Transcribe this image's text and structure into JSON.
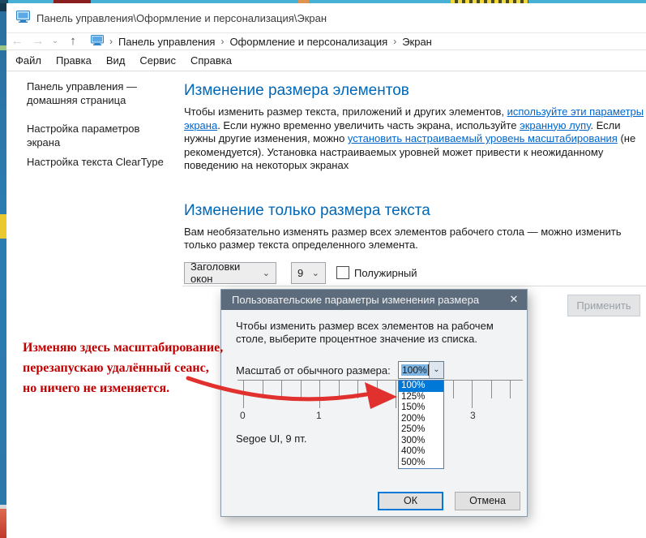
{
  "window": {
    "title": "Панель управления\\Оформление и персонализация\\Экран"
  },
  "icons": {
    "back": "←",
    "forward": "→",
    "dropdown_small": "⌄",
    "up": "↑",
    "breadcrumb_sep": "›",
    "combo_chevron": "⌄",
    "close": "✕"
  },
  "nav": {
    "breadcrumb": [
      "Панель управления",
      "Оформление и персонализация",
      "Экран"
    ]
  },
  "menu": {
    "items": [
      "Файл",
      "Правка",
      "Вид",
      "Сервис",
      "Справка"
    ]
  },
  "sidebar": {
    "items": [
      "Панель управления — домашняя страница",
      "Настройка параметров экрана",
      "Настройка текста ClearType"
    ]
  },
  "main": {
    "section1": {
      "title": "Изменение размера элементов",
      "t1": "Чтобы изменить размер текста, приложений и других элементов, ",
      "link1": "используйте эти параметры экрана",
      "t2": ". Если нужно временно увеличить часть экрана, используйте ",
      "link2": "экранную лупу",
      "t3": ". Если нужны другие изменения, можно ",
      "link3": "установить настраиваемый уровень масштабирования",
      "t4": " (не рекомендуется). Установка настраиваемых уровней может привести к неожиданному поведению на некоторых экранах"
    },
    "section2": {
      "title": "Изменение только размера текста",
      "body": "Вам необязательно изменять размер всех элементов рабочего стола — можно изменить только размер текста определенного элемента.",
      "element_combo_value": "Заголовки окон",
      "size_combo_value": "9",
      "bold_checkbox_label": "Полужирный"
    },
    "apply_button": "Применить"
  },
  "dialog": {
    "title": "Пользовательские параметры изменения размера",
    "body": "Чтобы изменить размер всех элементов на рабочем столе, выберите процентное значение из списка.",
    "scale_label": "Масштаб от обычного размера:",
    "combo_value": "100%",
    "ruler_labels": [
      "0",
      "1",
      "3"
    ],
    "font_note": "Segoe UI, 9 пт.",
    "options": [
      "100%",
      "125%",
      "150%",
      "200%",
      "250%",
      "300%",
      "400%",
      "500%"
    ],
    "selected_option": "100%",
    "ok_button": "ОК",
    "cancel_button": "Отмена"
  },
  "annotation": {
    "line1": "Изменяю здесь масштабирование,",
    "line2": "перезапускаю удалённый сеанс,",
    "line3": "но ничего не изменяется."
  },
  "colors": {
    "heading_blue": "#0068b8",
    "link_blue": "#0066cc",
    "dialog_titlebar": "#5c6c7d",
    "selection_blue": "#0078d7",
    "annotation_red": "#bf0000",
    "arrow_red": "#e0312e"
  }
}
